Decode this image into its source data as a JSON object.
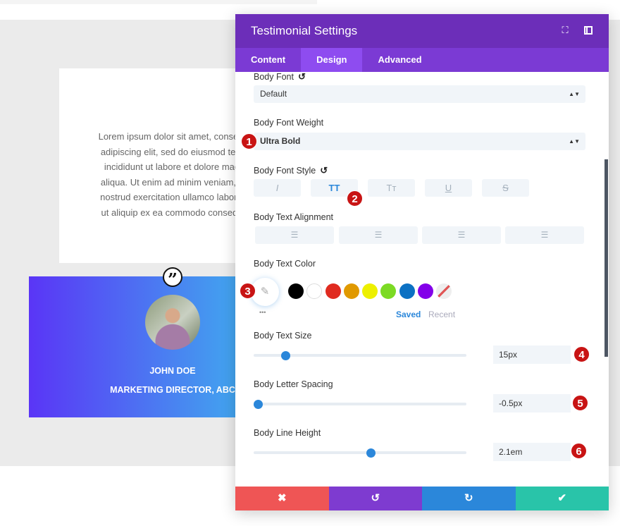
{
  "preview": {
    "body_lines": [
      "Lorem ipsum dolor sit amet, consect",
      "adipiscing elit, sed do eiusmod tem",
      "incididunt ut labore et dolore mag",
      "aliqua. Ut enim ad minim veniam, c",
      "nostrud exercitation ullamco laboris",
      "ut aliquip ex ea commodo consequ"
    ],
    "quote_icon": "closing-quote-icon",
    "name": "JOHN DOE",
    "position": "MARKETING DIRECTOR, ABC",
    "gradient": [
      "#5a35f6",
      "#42a4ef"
    ]
  },
  "modal": {
    "title": "Testimonial Settings",
    "header_icons": [
      "fullscreen-icon",
      "sidebar-toggle-icon"
    ],
    "tabs": [
      {
        "label": "Content"
      },
      {
        "label": "Design",
        "active": true
      },
      {
        "label": "Advanced"
      }
    ],
    "body_font": {
      "label": "Body Font",
      "value": "Default"
    },
    "body_font_weight": {
      "label": "Body Font Weight",
      "value": "Ultra Bold"
    },
    "body_font_style": {
      "label": "Body Font Style",
      "buttons": [
        "I",
        "TT",
        "Tт",
        "U",
        "S"
      ],
      "active": "TT"
    },
    "body_text_alignment": {
      "label": "Body Text Alignment",
      "options": [
        "left",
        "center",
        "right",
        "justify"
      ]
    },
    "body_text_color": {
      "label": "Body Text Color",
      "swatches": [
        "#000000",
        "#ffffff",
        "#e02b20",
        "#e09900",
        "#edf000",
        "#7cda24",
        "#0c71c3",
        "#8300e9"
      ],
      "saved_label": "Saved",
      "recent_label": "Recent",
      "more": "•••"
    },
    "body_text_size": {
      "label": "Body Text Size",
      "value": "15px",
      "slider_fraction": 0.15
    },
    "body_letter_spacing": {
      "label": "Body Letter Spacing",
      "value": "-0.5px",
      "slider_fraction": 0.02
    },
    "body_line_height": {
      "label": "Body Line Height",
      "value": "2.1em",
      "slider_fraction": 0.55
    },
    "footer": {
      "cancel": "✖",
      "undo": "↺",
      "redo": "↻",
      "save": "✔"
    },
    "colors": {
      "header": "#6c2eb9",
      "tabs": "#7b3ad4",
      "cancel": "#ef5555",
      "undo": "#7e3bd0",
      "redo": "#2b87da",
      "save": "#29c4a9",
      "accent": "#2b87da",
      "badge": "#c81414"
    }
  },
  "badges": [
    "1",
    "2",
    "3",
    "4",
    "5",
    "6"
  ]
}
